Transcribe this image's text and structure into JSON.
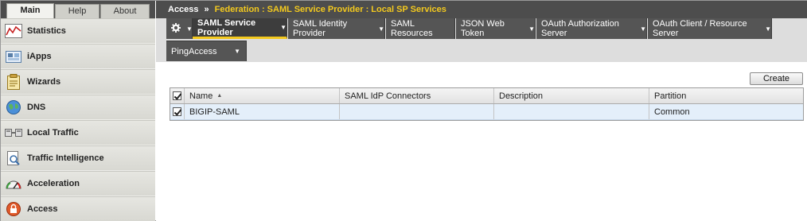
{
  "left_tabs": [
    {
      "label": "Main",
      "active": true
    },
    {
      "label": "Help",
      "active": false
    },
    {
      "label": "About",
      "active": false
    }
  ],
  "menu": [
    {
      "label": "Statistics",
      "icon": "statistics-chart-icon"
    },
    {
      "label": "iApps",
      "icon": "iapps-icon"
    },
    {
      "label": "Wizards",
      "icon": "wizards-clipboard-icon"
    },
    {
      "label": "DNS",
      "icon": "dns-globe-icon"
    },
    {
      "label": "Local Traffic",
      "icon": "local-traffic-icon"
    },
    {
      "label": "Traffic Intelligence",
      "icon": "traffic-intelligence-icon"
    },
    {
      "label": "Acceleration",
      "icon": "acceleration-gauge-icon"
    },
    {
      "label": "Access",
      "icon": "access-lock-icon"
    }
  ],
  "breadcrumb": {
    "root": "Access",
    "separator": "»",
    "path": "Federation : SAML Service Provider : Local SP Services"
  },
  "nav": {
    "gear_icon": "gear-icon",
    "items": [
      {
        "label": "SAML Service Provider",
        "active": true
      },
      {
        "label": "SAML Identity Provider",
        "active": false
      },
      {
        "label": "SAML Resources",
        "active": false
      },
      {
        "label": "JSON Web Token",
        "active": false
      },
      {
        "label": "OAuth Authorization Server",
        "active": false
      },
      {
        "label": "OAuth Client / Resource Server",
        "active": false
      },
      {
        "label": "PingAccess",
        "active": false
      }
    ]
  },
  "create_label": "Create",
  "table": {
    "columns": [
      "Name",
      "SAML IdP Connectors",
      "Description",
      "Partition"
    ],
    "sort_indicator": "▲",
    "rows": [
      {
        "name": "BIGIP-SAML",
        "connectors": "",
        "description": "",
        "partition": "Common",
        "checked": true
      }
    ],
    "header_checked": true
  },
  "colors": {
    "accent": "#f3c91e",
    "header_bg": "#4d4d4d",
    "row_selected": "#e4effa"
  }
}
